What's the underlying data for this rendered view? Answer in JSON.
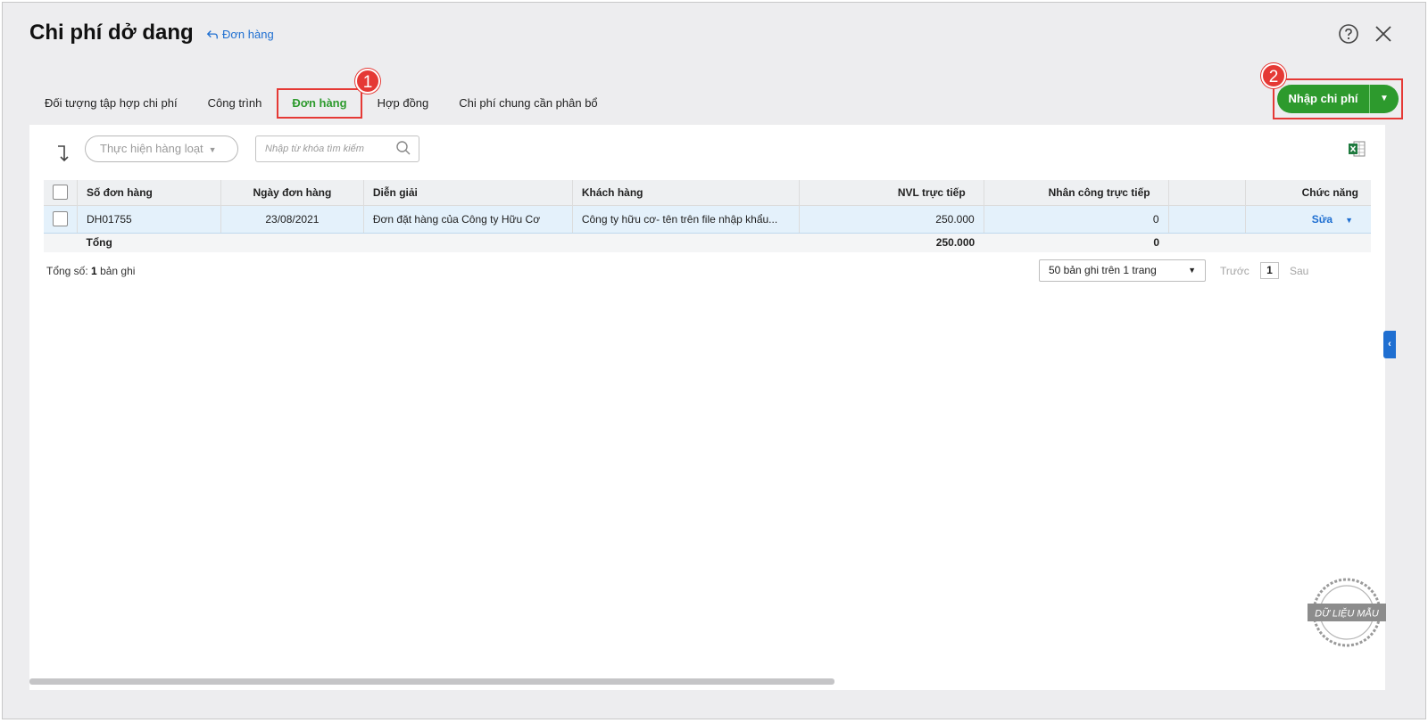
{
  "header": {
    "title": "Chi phí dở dang",
    "back_link": "Đơn hàng"
  },
  "tabs": [
    {
      "label": "Đối tượng tập hợp chi phí",
      "active": false
    },
    {
      "label": "Công trình",
      "active": false
    },
    {
      "label": "Đơn hàng",
      "active": true
    },
    {
      "label": "Hợp đồng",
      "active": false
    },
    {
      "label": "Chi phí chung cần phân bổ",
      "active": false
    }
  ],
  "annotations": {
    "step1": "1",
    "step2": "2"
  },
  "actions": {
    "primary_label": "Nhập chi phí"
  },
  "toolbar": {
    "bulk_action": "Thực hiện hàng loạt",
    "search_placeholder": "Nhập từ khóa tìm kiếm"
  },
  "table": {
    "columns": [
      "Số đơn hàng",
      "Ngày đơn hàng",
      "Diễn giải",
      "Khách hàng",
      "NVL trực tiếp",
      "Nhân công trực tiếp",
      "",
      "Chức năng"
    ],
    "rows": [
      {
        "order_no": "DH01755",
        "order_date": "23/08/2021",
        "description": "Đơn đặt hàng của Công ty Hữu Cơ",
        "customer": "Công ty hữu cơ- tên trên file nhập khẩu...",
        "direct_material": "250.000",
        "direct_labor": "0",
        "action": "Sửa"
      }
    ],
    "total": {
      "label": "Tổng",
      "direct_material": "250.000",
      "direct_labor": "0"
    }
  },
  "footer": {
    "count_label": "Tổng số:",
    "count_value": "1",
    "count_suffix": "bản ghi",
    "page_size": "50 bản ghi trên 1 trang",
    "prev": "Trước",
    "page": "1",
    "next": "Sau"
  },
  "watermark": "DỮ LIỆU MẪU",
  "colors": {
    "accent_green": "#2d9a2d",
    "link_blue": "#1f6fd1",
    "highlight_red": "#e53935"
  }
}
